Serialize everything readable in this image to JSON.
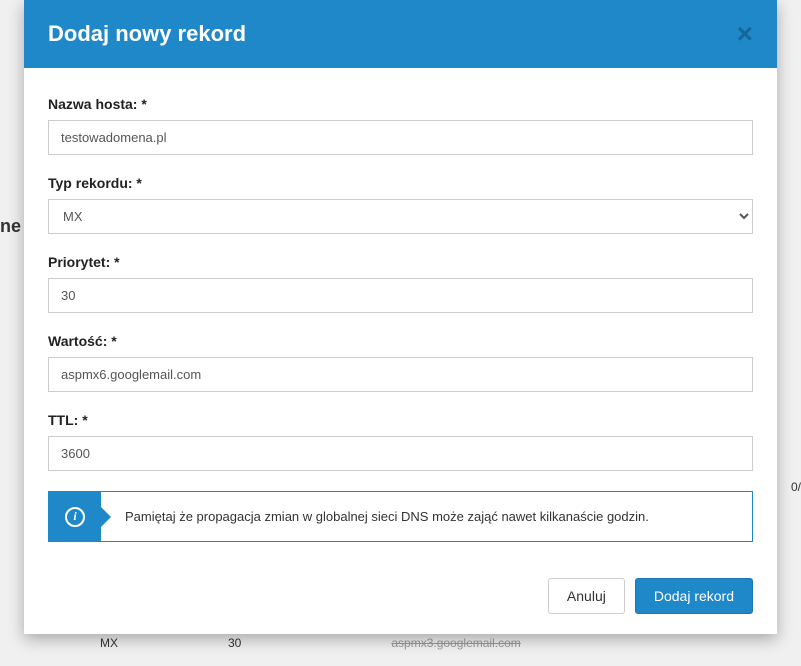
{
  "modal": {
    "title": "Dodaj nowy rekord",
    "close_label": "×"
  },
  "form": {
    "hostname": {
      "label": "Nazwa hosta: *",
      "value": "testowadomena.pl"
    },
    "record_type": {
      "label": "Typ rekordu: *",
      "value": "MX"
    },
    "priority": {
      "label": "Priorytet: *",
      "value": "30"
    },
    "value": {
      "label": "Wartość: *",
      "value": "aspmx6.googlemail.com"
    },
    "ttl": {
      "label": "TTL: *",
      "value": "3600"
    }
  },
  "info": {
    "icon": "i",
    "text": "Pamiętaj że propagacja zmian w globalnej sieci DNS może zająć nawet kilkanaście godzin."
  },
  "footer": {
    "cancel_label": "Anuluj",
    "submit_label": "Dodaj rekord"
  },
  "background": {
    "left_text": "ne",
    "right_text": "0/",
    "row": {
      "type": "MX",
      "priority": "30",
      "value": "aspmx3.googlemail.com"
    }
  }
}
